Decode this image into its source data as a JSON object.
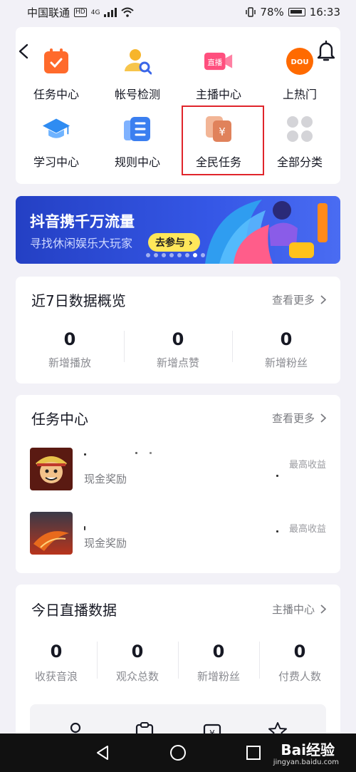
{
  "status_bar": {
    "carrier": "中国联通",
    "hd": "HD",
    "network": "4G",
    "battery": "78%",
    "time": "16:33"
  },
  "tools": [
    {
      "label": "任务中心",
      "icon": "task-calendar-icon",
      "color": "#ff6a2b"
    },
    {
      "label": "帐号检测",
      "icon": "account-check-icon",
      "color": "#f7b52b"
    },
    {
      "label": "主播中心",
      "icon": "live-camera-icon",
      "color": "#ff4f7e"
    },
    {
      "label": "上热门",
      "icon": "dou-plus-icon",
      "color": "#ff6a00"
    },
    {
      "label": "学习中心",
      "icon": "graduation-cap-icon",
      "color": "#2f8cf2"
    },
    {
      "label": "规则中心",
      "icon": "rules-doc-icon",
      "color": "#3b7ff0"
    },
    {
      "label": "全民任务",
      "icon": "yuan-cards-icon",
      "color": "#e0825b"
    },
    {
      "label": "全部分类",
      "icon": "grid-dots-icon",
      "color": "#d4d4d8"
    }
  ],
  "banner": {
    "title": "抖音携千万流量",
    "subtitle": "寻找休闲娱乐大玩家",
    "button": "去参与 ›",
    "active_slide": 7,
    "slides": 8
  },
  "overview": {
    "title": "近7日数据概览",
    "more": "查看更多",
    "stats": [
      {
        "value": "0",
        "label": "新增播放"
      },
      {
        "value": "0",
        "label": "新增点赞"
      },
      {
        "value": "0",
        "label": "新增粉丝"
      }
    ]
  },
  "tasks": {
    "title": "任务中心",
    "more": "查看更多",
    "items": [
      {
        "name": "",
        "reward": "现金奖励",
        "max": "最高收益"
      },
      {
        "name": "",
        "reward": "现金奖励",
        "max": "最高收益"
      }
    ]
  },
  "live": {
    "title": "今日直播数据",
    "more": "主播中心",
    "stats": [
      {
        "value": "0",
        "label": "收获音浪"
      },
      {
        "value": "0",
        "label": "观众总数"
      },
      {
        "value": "0",
        "label": "新增粉丝"
      },
      {
        "value": "0",
        "label": "付费人数"
      }
    ]
  },
  "watermark": {
    "brand": "Bai经验",
    "url": "jingyan.baidu.com"
  }
}
